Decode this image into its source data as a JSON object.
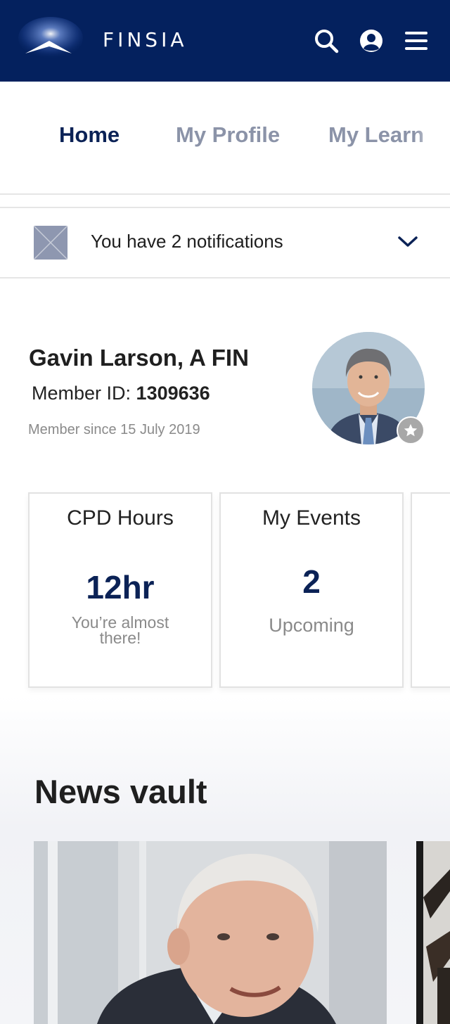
{
  "header": {
    "brand": "FINSIA",
    "icons": [
      "search-icon",
      "user-icon",
      "menu-icon"
    ],
    "background": "#04215e"
  },
  "tabs": [
    {
      "label": "Home",
      "active": true
    },
    {
      "label": "My Profile",
      "active": false
    },
    {
      "label": "My Learn",
      "active": false
    }
  ],
  "notifications": {
    "text": "You have 2 notifications"
  },
  "member": {
    "name": "Gavin Larson, A FIN",
    "id_label": "Member ID:",
    "id_value": "1309636",
    "since": "Member since 15 July 2019"
  },
  "cards": {
    "cpd": {
      "title": "CPD Hours",
      "value": "12hr",
      "sub": "You’re almost there!"
    },
    "events": {
      "title": "My Events",
      "value": "2",
      "sub": "Upcoming"
    }
  },
  "news": {
    "title": "News vault"
  },
  "colors": {
    "primary": "#04215e",
    "accent_text": "#0b2256",
    "muted": "#8b93a8"
  }
}
